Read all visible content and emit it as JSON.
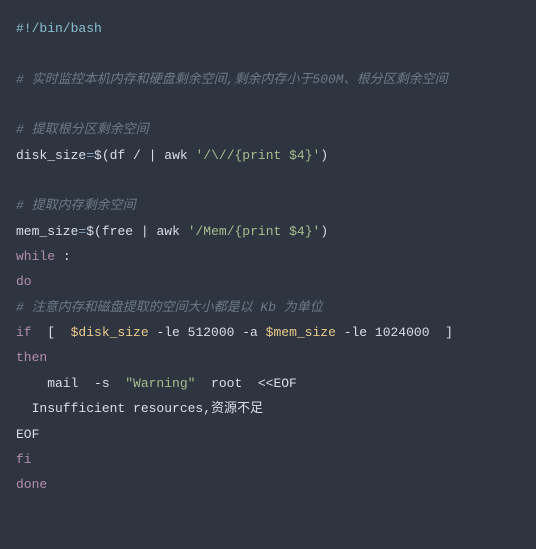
{
  "code": {
    "shebang": "#!/bin/bash",
    "comment_desc": "# 实时监控本机内存和硬盘剩余空间,剩余内存小于500M、根分区剩余空间",
    "comment_disk": "# 提取根分区剩余空间",
    "disk_var": "disk_size",
    "assign": "=",
    "dollar_open": "$(",
    "df_cmd": "df / ",
    "pipe": "|",
    "awk": " awk ",
    "disk_pattern": "'/\\//{print $4}'",
    "close_paren": ")",
    "comment_mem": "# 提取内存剩余空间",
    "mem_var": "mem_size",
    "free_cmd": "free ",
    "mem_pattern": "'/Mem/{print $4}'",
    "kw_while": "while",
    "colon": " :",
    "kw_do": "do",
    "comment_kb": "# 注意内存和磁盘提取的空间大小都是以 Kb 为单位",
    "kw_if": "if",
    "lbracket": "  [  ",
    "ref_disk": "$disk_size",
    "le1": " -le 512000 -a ",
    "ref_mem": "$mem_size",
    "le2": " -le 1024000  ]",
    "kw_then": "then",
    "mail_line_pre": "    mail  -s  ",
    "mail_warning": "\"Warning\"",
    "mail_line_post": "  root  <<EOF",
    "resource_line": "  Insufficient resources,资源不足",
    "eof": "EOF",
    "kw_fi": "fi",
    "kw_done": "done"
  }
}
